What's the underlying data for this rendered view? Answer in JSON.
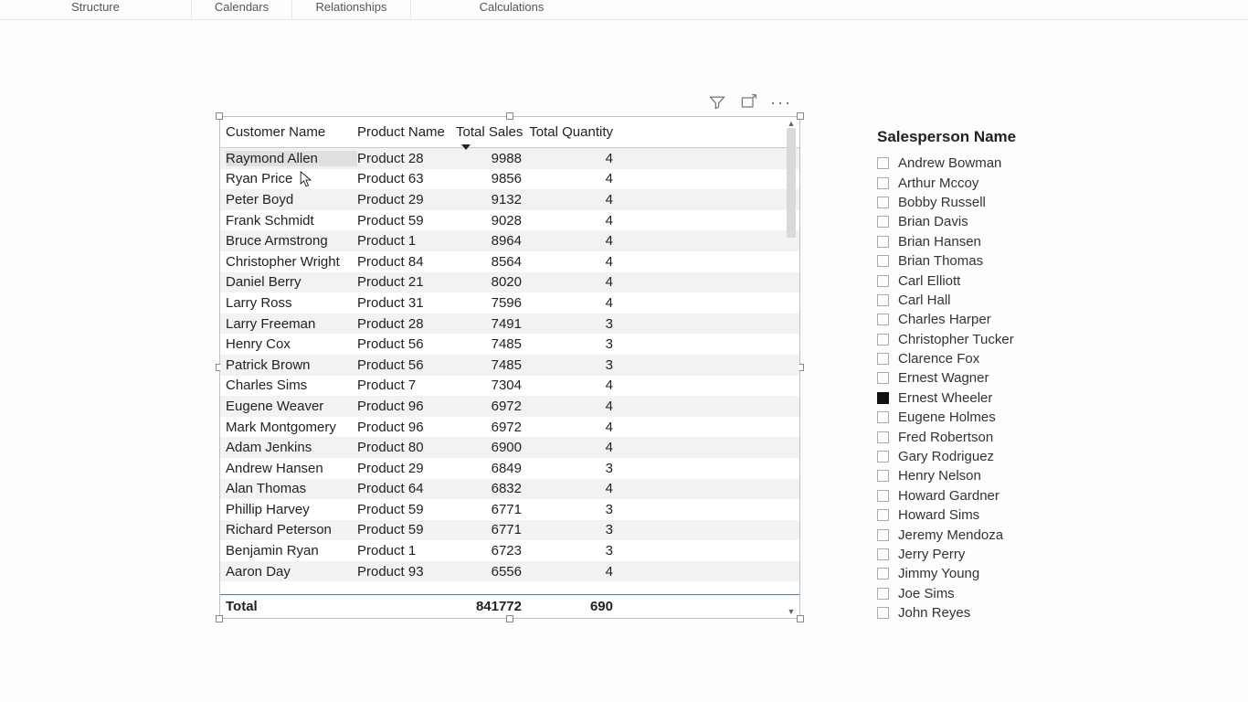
{
  "ribbon": {
    "groups": [
      "Structure",
      "Calendars",
      "Relationships",
      "Calculations"
    ]
  },
  "table": {
    "headers": [
      "Customer Name",
      "Product Name",
      "Total Sales",
      "Total Quantity"
    ],
    "rows": [
      {
        "name": "Raymond Allen",
        "prod": "Product 28",
        "sales": "9988",
        "qty": "4"
      },
      {
        "name": "Ryan Price",
        "prod": "Product 63",
        "sales": "9856",
        "qty": "4"
      },
      {
        "name": "Peter Boyd",
        "prod": "Product 29",
        "sales": "9132",
        "qty": "4"
      },
      {
        "name": "Frank Schmidt",
        "prod": "Product 59",
        "sales": "9028",
        "qty": "4"
      },
      {
        "name": "Bruce Armstrong",
        "prod": "Product 1",
        "sales": "8964",
        "qty": "4"
      },
      {
        "name": "Christopher Wright",
        "prod": "Product 84",
        "sales": "8564",
        "qty": "4"
      },
      {
        "name": "Daniel Berry",
        "prod": "Product 21",
        "sales": "8020",
        "qty": "4"
      },
      {
        "name": "Larry Ross",
        "prod": "Product 31",
        "sales": "7596",
        "qty": "4"
      },
      {
        "name": "Larry Freeman",
        "prod": "Product 28",
        "sales": "7491",
        "qty": "3"
      },
      {
        "name": "Henry Cox",
        "prod": "Product 56",
        "sales": "7485",
        "qty": "3"
      },
      {
        "name": "Patrick Brown",
        "prod": "Product 56",
        "sales": "7485",
        "qty": "3"
      },
      {
        "name": "Charles Sims",
        "prod": "Product 7",
        "sales": "7304",
        "qty": "4"
      },
      {
        "name": "Eugene Weaver",
        "prod": "Product 96",
        "sales": "6972",
        "qty": "4"
      },
      {
        "name": "Mark Montgomery",
        "prod": "Product 96",
        "sales": "6972",
        "qty": "4"
      },
      {
        "name": "Adam Jenkins",
        "prod": "Product 80",
        "sales": "6900",
        "qty": "4"
      },
      {
        "name": "Andrew Hansen",
        "prod": "Product 29",
        "sales": "6849",
        "qty": "3"
      },
      {
        "name": "Alan Thomas",
        "prod": "Product 64",
        "sales": "6832",
        "qty": "4"
      },
      {
        "name": "Phillip Harvey",
        "prod": "Product 59",
        "sales": "6771",
        "qty": "3"
      },
      {
        "name": "Richard Peterson",
        "prod": "Product 59",
        "sales": "6771",
        "qty": "3"
      },
      {
        "name": "Benjamin Ryan",
        "prod": "Product 1",
        "sales": "6723",
        "qty": "3"
      },
      {
        "name": "Aaron Day",
        "prod": "Product 93",
        "sales": "6556",
        "qty": "4"
      }
    ],
    "footer": {
      "label": "Total",
      "sales": "841772",
      "qty": "690"
    }
  },
  "slicer": {
    "title": "Salesperson Name",
    "items": [
      {
        "label": "Andrew Bowman",
        "checked": false
      },
      {
        "label": "Arthur Mccoy",
        "checked": false
      },
      {
        "label": "Bobby Russell",
        "checked": false
      },
      {
        "label": "Brian Davis",
        "checked": false
      },
      {
        "label": "Brian Hansen",
        "checked": false
      },
      {
        "label": "Brian Thomas",
        "checked": false
      },
      {
        "label": "Carl Elliott",
        "checked": false
      },
      {
        "label": "Carl Hall",
        "checked": false
      },
      {
        "label": "Charles Harper",
        "checked": false
      },
      {
        "label": "Christopher Tucker",
        "checked": false
      },
      {
        "label": "Clarence Fox",
        "checked": false
      },
      {
        "label": "Ernest Wagner",
        "checked": false
      },
      {
        "label": "Ernest Wheeler",
        "checked": true
      },
      {
        "label": "Eugene Holmes",
        "checked": false
      },
      {
        "label": "Fred Robertson",
        "checked": false
      },
      {
        "label": "Gary Rodriguez",
        "checked": false
      },
      {
        "label": "Henry Nelson",
        "checked": false
      },
      {
        "label": "Howard Gardner",
        "checked": false
      },
      {
        "label": "Howard Sims",
        "checked": false
      },
      {
        "label": "Jeremy Mendoza",
        "checked": false
      },
      {
        "label": "Jerry Perry",
        "checked": false
      },
      {
        "label": "Jimmy Young",
        "checked": false
      },
      {
        "label": "Joe Sims",
        "checked": false
      },
      {
        "label": "John Reyes",
        "checked": false
      }
    ]
  },
  "icons": {
    "filter": "filter",
    "focus": "focus",
    "more": "more"
  }
}
